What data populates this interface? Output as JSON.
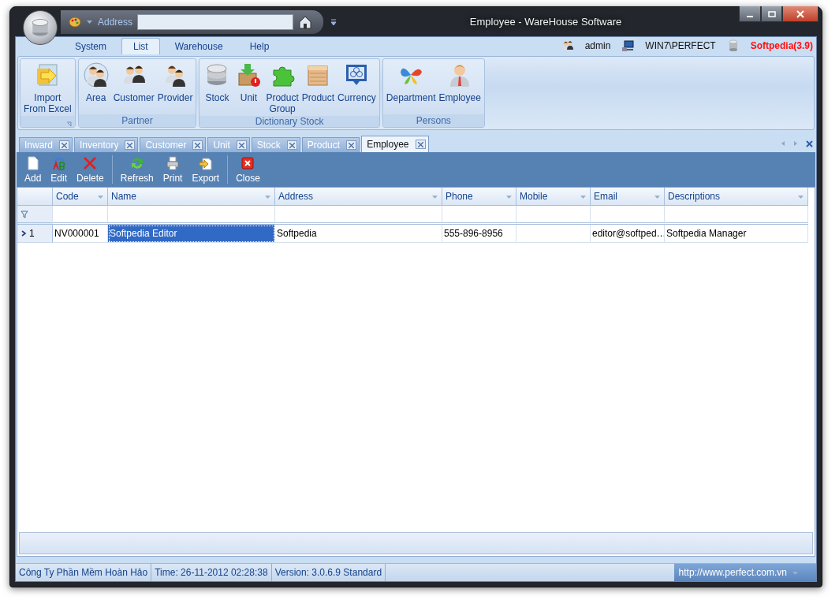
{
  "window": {
    "title": "Employee - WareHouse Software"
  },
  "quick_access": {
    "address_label": "Address"
  },
  "ribbon_tabs": [
    {
      "label": "System",
      "selected": false
    },
    {
      "label": "List",
      "selected": true
    },
    {
      "label": "Warehouse",
      "selected": false
    },
    {
      "label": "Help",
      "selected": false
    }
  ],
  "user_info": [
    {
      "kind": "user",
      "text": "admin"
    },
    {
      "kind": "computer",
      "text": "WIN7\\PERFECT"
    },
    {
      "kind": "database",
      "text": "Softpedia(3.9)"
    }
  ],
  "ribbon_groups": [
    {
      "launcher": true,
      "items": [
        {
          "kind": "import",
          "label": "Import\nFrom Excel"
        }
      ]
    },
    {
      "title": "Partner",
      "items": [
        {
          "kind": "area",
          "label": "Area"
        },
        {
          "kind": "customer",
          "label": "Customer"
        },
        {
          "kind": "provider",
          "label": "Provider"
        }
      ]
    },
    {
      "title": "Dictionary Stock",
      "items": [
        {
          "kind": "stock",
          "label": "Stock"
        },
        {
          "kind": "unit",
          "label": "Unit"
        },
        {
          "kind": "group",
          "label": "Product\nGroup"
        },
        {
          "kind": "product",
          "label": "Product"
        },
        {
          "kind": "currency",
          "label": "Currency"
        }
      ]
    },
    {
      "title": "Persons",
      "items": [
        {
          "kind": "department",
          "label": "Department"
        },
        {
          "kind": "employee",
          "label": "Employee"
        }
      ]
    }
  ],
  "doc_tabs": [
    {
      "label": "Inward",
      "selected": false
    },
    {
      "label": "Inventory",
      "selected": false
    },
    {
      "label": "Customer",
      "selected": false
    },
    {
      "label": "Unit",
      "selected": false
    },
    {
      "label": "Stock",
      "selected": false
    },
    {
      "label": "Product",
      "selected": false
    },
    {
      "label": "Employee",
      "selected": true
    }
  ],
  "toolbar_groups": [
    [
      {
        "kind": "add",
        "label": "Add"
      },
      {
        "kind": "edit",
        "label": "Edit"
      },
      {
        "kind": "delete",
        "label": "Delete"
      }
    ],
    [
      {
        "kind": "refresh",
        "label": "Refresh"
      },
      {
        "kind": "print",
        "label": "Print"
      },
      {
        "kind": "export",
        "label": "Export"
      }
    ],
    [
      {
        "kind": "close",
        "label": "Close"
      }
    ]
  ],
  "grid": {
    "columns": [
      {
        "label": "Code"
      },
      {
        "label": "Name"
      },
      {
        "label": "Address"
      },
      {
        "label": "Phone"
      },
      {
        "label": "Mobile"
      },
      {
        "label": "Email"
      },
      {
        "label": "Descriptions"
      }
    ],
    "rows": [
      {
        "indicator": "1",
        "current": true,
        "cells": [
          {
            "text": "NV000001",
            "selected": false
          },
          {
            "text": "Softpedia Editor",
            "selected": true
          },
          {
            "text": "Softpedia",
            "selected": false
          },
          {
            "text": "555-896-8956",
            "selected": false
          },
          {
            "selected": false
          },
          {
            "text": "editor@softped…",
            "selected": false
          },
          {
            "text": "Softpedia Manager",
            "selected": false
          }
        ]
      }
    ]
  },
  "status_bar": {
    "items": [
      "Công Ty Phần Mềm Hoàn Hảo",
      "Time: 26-11-2012 02:28:38",
      "Version: 3.0.6.9 Standard"
    ],
    "link": "http://www.perfect.com.vn"
  }
}
